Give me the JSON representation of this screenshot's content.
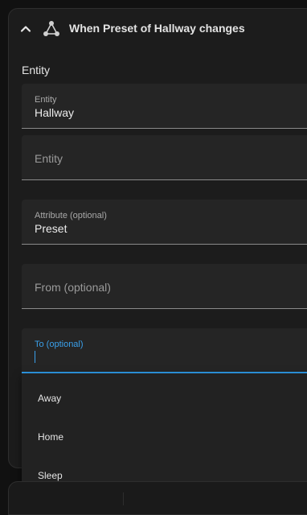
{
  "trigger": {
    "title": "When Preset of Hallway changes",
    "icon": "state-trigger-icon",
    "expand_icon": "chevron-up-icon"
  },
  "section": {
    "label": "Entity"
  },
  "fields": {
    "entity": {
      "label": "Entity",
      "value": "Hallway"
    },
    "entity_add": {
      "placeholder": "Entity"
    },
    "attribute": {
      "label": "Attribute (optional)",
      "value": "Preset"
    },
    "from": {
      "placeholder": "From (optional)"
    },
    "to": {
      "label": "To (optional)",
      "value": ""
    }
  },
  "dropdown": {
    "options": [
      "Away",
      "Home",
      "Sleep"
    ]
  },
  "colors": {
    "accent": "#2f9be8",
    "card_background": "#1c1c1c",
    "field_background": "#252525"
  }
}
